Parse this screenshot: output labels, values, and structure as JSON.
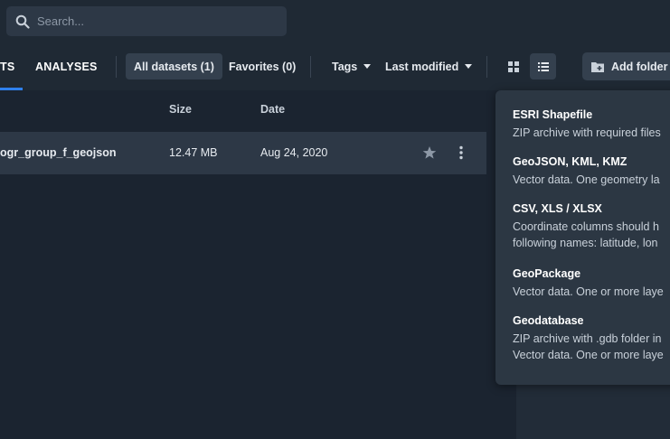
{
  "search": {
    "placeholder": "Search..."
  },
  "tabs": {
    "datasets_partial": "TS",
    "analyses": "ANALYSES"
  },
  "filters": {
    "all_datasets": "All datasets (1)",
    "favorites": "Favorites (0)",
    "tags": "Tags",
    "sort": "Last modified"
  },
  "view_toggle": {
    "grid_icon": "grid-view-icon",
    "list_icon": "list-view-icon",
    "active": "list"
  },
  "add_folder": {
    "label": "Add folder",
    "icon": "folder-plus-icon"
  },
  "table": {
    "headers": {
      "size": "Size",
      "date": "Date"
    },
    "rows": [
      {
        "name": "ogr_group_f_geojson",
        "size": "12.47 MB",
        "date": "Aug 24, 2020"
      }
    ]
  },
  "formats": [
    {
      "title": "ESRI Shapefile",
      "lines": [
        "ZIP archive with required files"
      ]
    },
    {
      "title": "GeoJSON, KML, KMZ",
      "lines": [
        "Vector data. One geometry la"
      ]
    },
    {
      "title": "CSV, XLS / XLSX",
      "lines": [
        "Coordinate columns should h",
        "following names: latitude, lon"
      ]
    },
    {
      "title": "GeoPackage",
      "lines": [
        "Vector data. One or more laye"
      ]
    },
    {
      "title": "Geodatabase",
      "lines": [
        "ZIP archive with .gdb folder in",
        "Vector data. One or more laye"
      ]
    }
  ],
  "colors": {
    "background": "#1b2430",
    "panel": "#2c3743",
    "accent": "#2f80ed",
    "row": "#2d3846"
  }
}
